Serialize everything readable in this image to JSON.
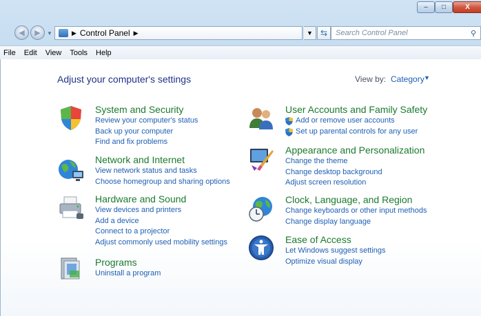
{
  "window": {
    "minimize_glyph": "–",
    "maximize_glyph": "□",
    "close_glyph": "X"
  },
  "address": {
    "crumb": "Control Panel",
    "search_placeholder": "Search Control Panel"
  },
  "menu": [
    {
      "label": "File"
    },
    {
      "label": "Edit"
    },
    {
      "label": "View"
    },
    {
      "label": "Tools"
    },
    {
      "label": "Help"
    }
  ],
  "heading": "Adjust your computer's settings",
  "view_by": {
    "label": "View by:",
    "value": "Category"
  },
  "categories": {
    "system": {
      "title": "System and Security",
      "links": [
        "Review your computer's status",
        "Back up your computer",
        "Find and fix problems"
      ]
    },
    "network": {
      "title": "Network and Internet",
      "links": [
        "View network status and tasks",
        "Choose homegroup and sharing options"
      ]
    },
    "hardware": {
      "title": "Hardware and Sound",
      "links": [
        "View devices and printers",
        "Add a device",
        "Connect to a projector",
        "Adjust commonly used mobility settings"
      ]
    },
    "programs": {
      "title": "Programs",
      "links": [
        "Uninstall a program"
      ]
    },
    "users": {
      "title": "User Accounts and Family Safety",
      "links": [
        "Add or remove user accounts",
        "Set up parental controls for any user"
      ]
    },
    "appearance": {
      "title": "Appearance and Personalization",
      "links": [
        "Change the theme",
        "Change desktop background",
        "Adjust screen resolution"
      ]
    },
    "clock": {
      "title": "Clock, Language, and Region",
      "links": [
        "Change keyboards or other input methods",
        "Change display language"
      ]
    },
    "ease": {
      "title": "Ease of Access",
      "links": [
        "Let Windows suggest settings",
        "Optimize visual display"
      ]
    }
  }
}
